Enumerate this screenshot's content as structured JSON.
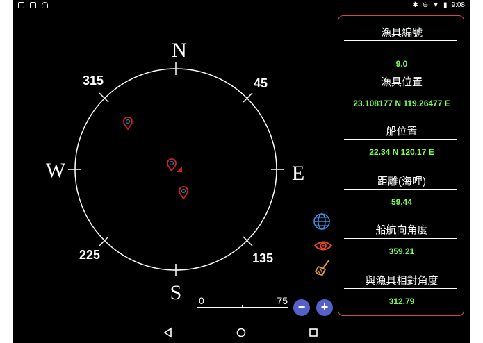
{
  "status_bar": {
    "time": "9:08",
    "left_icons": [
      "app-icon",
      "sim-icon",
      "android-icon"
    ],
    "right_icons": [
      "bluetooth-icon",
      "dnd-icon",
      "wifi-icon",
      "battery-icon"
    ]
  },
  "compass": {
    "cardinals": {
      "north": "N",
      "east": "E",
      "south": "S",
      "west": "W"
    },
    "degree_labels": {
      "d45": "45",
      "d135": "135",
      "d225": "225",
      "d315": "315"
    },
    "markers": [
      "map-pin-icon",
      "map-pin-icon",
      "map-pin-icon"
    ],
    "ship_icon": "ship-triangle-icon"
  },
  "info_panel": {
    "gear_id_label": "漁具編號",
    "gear_id_value": "9.0",
    "gear_pos_label": "漁具位置",
    "gear_pos_value": "23.108177 N 119.26477 E",
    "ship_pos_label": "船位置",
    "ship_pos_value": "22.34 N 120.17 E",
    "distance_label": "距離(海哩)",
    "distance_value": "59.44",
    "heading_label": "船航向角度",
    "heading_value": "359.21",
    "relative_angle_label": "與漁具相對角度",
    "relative_angle_value": "312.79"
  },
  "tools": {
    "globe": "globe-icon",
    "eye": "eye-icon",
    "broom": "broom-icon"
  },
  "scale_bar": {
    "min": "0",
    "max": "75"
  },
  "zoom": {
    "out": "−",
    "in": "+"
  },
  "colors": {
    "value_green": "#7dff57",
    "panel_border": "#d04a5a",
    "zoom_blue": "#5560c8",
    "marker_red": "#cc2222",
    "globe_blue": "#3b8de0",
    "eye_red": "#e0452e",
    "broom_orange": "#e09a30"
  }
}
